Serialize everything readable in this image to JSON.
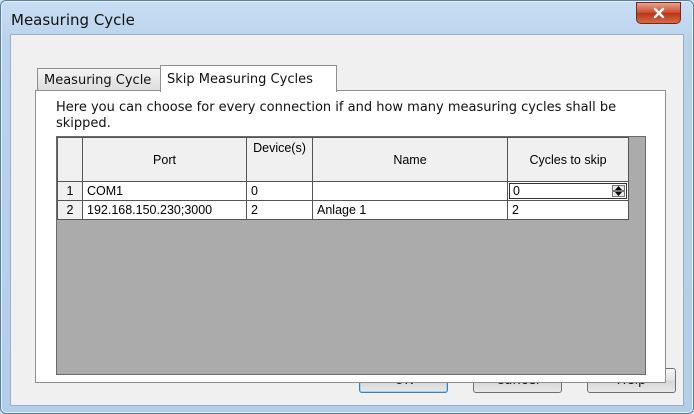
{
  "window": {
    "title": "Measuring Cycle"
  },
  "tabs": [
    {
      "label": "Measuring Cycle",
      "active": false
    },
    {
      "label": "Skip Measuring Cycles",
      "active": true
    }
  ],
  "description": "Here you can choose for every connection if and how many measuring cycles shall be skipped.",
  "grid": {
    "columns": [
      "Port",
      "Device(s)",
      "Name",
      "Cycles to skip"
    ],
    "rows": [
      {
        "num": "1",
        "port": "COM1",
        "devices": "0",
        "name": "",
        "cycles": "0"
      },
      {
        "num": "2",
        "port": "192.168.150.230;3000",
        "devices": "2",
        "name": "Anlage 1",
        "cycles": "2"
      }
    ]
  },
  "buttons": {
    "ok": "OK",
    "cancel": "Cancel",
    "help": "Help"
  },
  "icons": {
    "close": "close-icon",
    "spin_up": "arrow-up-icon",
    "spin_down": "arrow-down-icon"
  }
}
